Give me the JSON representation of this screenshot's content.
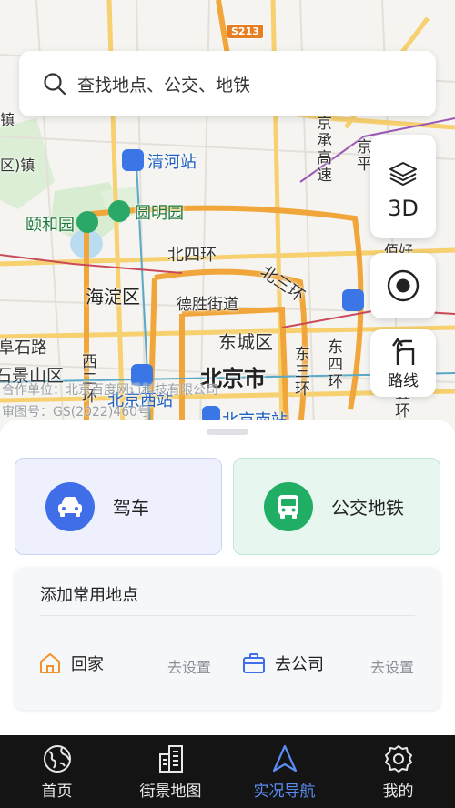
{
  "map": {
    "road_shield": "S213",
    "labels": {
      "qinghe_station": "清河站",
      "yiheyuan": "颐和园",
      "yuanmingyuan": "圆明园",
      "north_4th_ring": "北四环",
      "north_3rd_ring": "北三环",
      "haidian": "海淀区",
      "deshengjie": "德胜街道",
      "dongcheng": "东城区",
      "beijing": "北京市",
      "shijingshan": "石景山区",
      "west_2nd_ring": "西二环",
      "beijing_west_station": "北京西站",
      "beijing_south_station": "北京南站",
      "east_3rd_ring": "东三环",
      "east_4th_ring": "东四环",
      "east_5th_ring": "东五环",
      "jingcheng_highway": "京承高速",
      "jingping": "京平",
      "dinghao": "佰好",
      "left_zhen": "镇",
      "left_town": "区)镇",
      "left_road": "阜石路",
      "copyright_owner": "合作单位：北京百度网讯科技有限公司",
      "copyright_number": "审图号：GS(2022)460号"
    }
  },
  "search": {
    "placeholder": "查找地点、公交、地铁"
  },
  "controls": {
    "layers_icon": "layers-icon",
    "mode_3d": "3D",
    "locate_icon": "locate-icon",
    "route_label": "路线"
  },
  "sheet": {
    "drive_label": "驾车",
    "transit_label": "公交地铁",
    "places_title": "添加常用地点",
    "home_label": "回家",
    "home_action": "去设置",
    "work_label": "去公司",
    "work_action": "去设置"
  },
  "tabs": [
    {
      "label": "首页",
      "icon": "globe-icon",
      "active": false
    },
    {
      "label": "街景地图",
      "icon": "buildings-icon",
      "active": false
    },
    {
      "label": "实况导航",
      "icon": "navigation-arrow-icon",
      "active": true
    },
    {
      "label": "我的",
      "icon": "gear-icon",
      "active": false
    }
  ],
  "colors": {
    "accent": "#5b8cf2",
    "drive": "#3f6ee8",
    "transit": "#1fae63",
    "tabbar": "#141414"
  }
}
